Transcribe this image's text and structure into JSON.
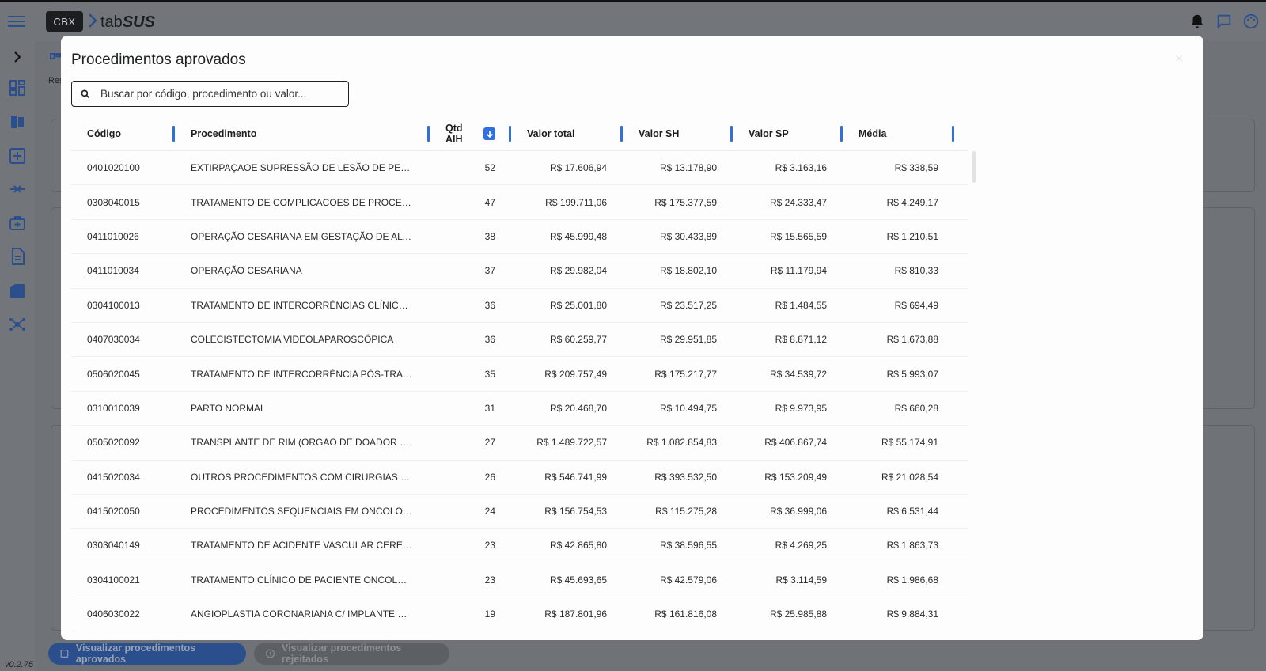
{
  "app": {
    "logo_box": "CBX",
    "logo_prefix": "tab",
    "logo_suffix": "SUS",
    "version": "v0.2.75"
  },
  "background": {
    "approved_button": "Visualizar procedimentos aprovados",
    "rejected_button": "Visualizar procedimentos rejeitados",
    "partial_label": "Res"
  },
  "modal": {
    "title": "Procedimentos aprovados",
    "close": "×",
    "search_placeholder": "Buscar por código, procedimento ou valor...",
    "columns": {
      "codigo": "Código",
      "procedimento": "Procedimento",
      "qtd": "Qtd AIH",
      "valor_total": "Valor total",
      "valor_sh": "Valor SH",
      "valor_sp": "Valor SP",
      "media": "Média"
    },
    "rows": [
      [
        "0401020100",
        "EXTIRPAÇAOE SUPRESSÃO DE LESÃO DE PELE E DE TE...",
        "52",
        "R$ 17.606,94",
        "R$ 13.178,90",
        "R$ 3.163,16",
        "R$ 338,59"
      ],
      [
        "0308040015",
        "TRATAMENTO DE COMPLICACOES DE PROCEDIMENT...",
        "47",
        "R$ 199.711,06",
        "R$ 175.377,59",
        "R$ 24.333,47",
        "R$ 4.249,17"
      ],
      [
        "0411010026",
        "OPERAÇÃO CESARIANA EM GESTAÇÃO DE ALTO RISCO",
        "38",
        "R$ 45.999,48",
        "R$ 30.433,89",
        "R$ 15.565,59",
        "R$ 1.210,51"
      ],
      [
        "0411010034",
        "OPERAÇÃO CESARIANA",
        "37",
        "R$ 29.982,04",
        "R$ 18.802,10",
        "R$ 11.179,94",
        "R$ 810,33"
      ],
      [
        "0304100013",
        "TRATAMENTO DE INTERCORRÊNCIAS CLÍNICAS DE PA...",
        "36",
        "R$ 25.001,80",
        "R$ 23.517,25",
        "R$ 1.484,55",
        "R$ 694,49"
      ],
      [
        "0407030034",
        "COLECISTECTOMIA VIDEOLAPAROSCÓPICA",
        "36",
        "R$ 60.259,77",
        "R$ 29.951,85",
        "R$ 8.871,12",
        "R$ 1.673,88"
      ],
      [
        "0506020045",
        "TRATAMENTO DE INTERCORRÊNCIA PÓS-TRANSPLAN...",
        "35",
        "R$ 209.757,49",
        "R$ 175.217,77",
        "R$ 34.539,72",
        "R$ 5.993,07"
      ],
      [
        "0310010039",
        "PARTO NORMAL",
        "31",
        "R$ 20.468,70",
        "R$ 10.494,75",
        "R$ 9.973,95",
        "R$ 660,28"
      ],
      [
        "0505020092",
        "TRANSPLANTE DE RIM (ORGAO DE DOADOR FALECIDO)",
        "27",
        "R$ 1.489.722,57",
        "R$ 1.082.854,83",
        "R$ 406.867,74",
        "R$ 55.174,91"
      ],
      [
        "0415020034",
        "OUTROS PROCEDIMENTOS COM CIRURGIAS SEQUEN...",
        "26",
        "R$ 546.741,99",
        "R$ 393.532,50",
        "R$ 153.209,49",
        "R$ 21.028,54"
      ],
      [
        "0415020050",
        "PROCEDIMENTOS SEQUENCIAIS EM ONCOLOGIA",
        "24",
        "R$ 156.754,53",
        "R$ 115.275,28",
        "R$ 36.999,06",
        "R$ 6.531,44"
      ],
      [
        "0303040149",
        "TRATAMENTO DE ACIDENTE VASCULAR CEREBRAL - A...",
        "23",
        "R$ 42.865,80",
        "R$ 38.596,55",
        "R$ 4.269,25",
        "R$ 1.863,73"
      ],
      [
        "0304100021",
        "TRATAMENTO CLÍNICO DE PACIENTE ONCOLÓGICO",
        "23",
        "R$ 45.693,65",
        "R$ 42.579,06",
        "R$ 3.114,59",
        "R$ 1.986,68"
      ],
      [
        "0406030022",
        "ANGIOPLASTIA CORONARIANA C/ IMPLANTE DE DOI...",
        "19",
        "R$ 187.801,96",
        "R$ 161.816,08",
        "R$ 25.985,88",
        "R$ 9.884,31"
      ]
    ]
  },
  "colors": {
    "accent": "#2f6fde",
    "overlay": "#6f7378",
    "brand_dark": "#2b4f8c"
  }
}
